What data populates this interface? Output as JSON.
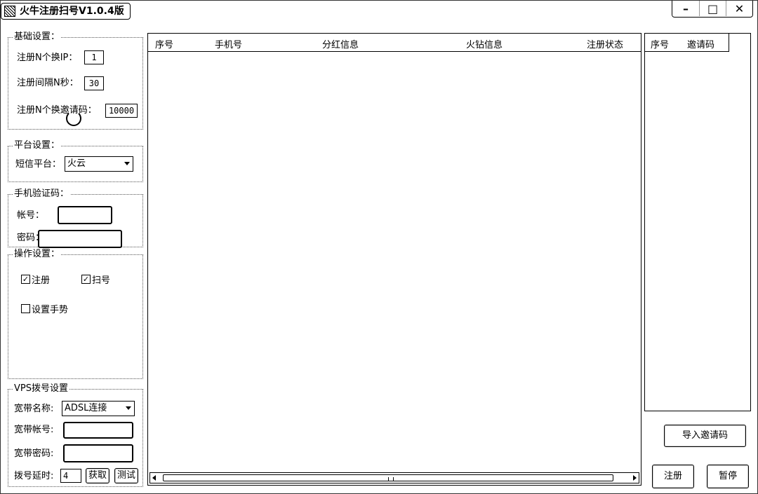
{
  "window": {
    "title": "火牛注册扫号V1.0.4版",
    "minimize_glyph": "–",
    "maximize_glyph": "□",
    "close_glyph": "✕"
  },
  "basic_settings": {
    "title": "基础设置：",
    "switch_ip_label": "注册N个换IP：",
    "switch_ip_value": "1",
    "interval_label": "注册间隔N秒：",
    "interval_value": "30",
    "switch_invite_label": "注册N个换邀请码：",
    "switch_invite_value": "10000"
  },
  "platform_settings": {
    "title": "平台设置：",
    "sms_label": "短信平台：",
    "sms_value": "火云"
  },
  "phone_verify": {
    "title": "手机验证码：",
    "account_label": "帐号：",
    "password_label": "密码："
  },
  "operation_settings": {
    "title": "操作设置：",
    "register_label": "注册",
    "register_checked": true,
    "scan_label": "扫号",
    "scan_checked": true,
    "gesture_label": "设置手势",
    "gesture_checked": false
  },
  "vps_settings": {
    "title": "VPS拨号设置",
    "broadband_name_label": "宽带名称:",
    "broadband_name_value": "ADSL连接",
    "broadband_account_label": "宽带帐号:",
    "broadband_password_label": "宽带密码:",
    "dial_delay_label": "拨号延时:",
    "dial_delay_value": "4",
    "fetch_button": "获取",
    "test_button": "测试"
  },
  "main_list": {
    "columns": [
      "序号",
      "手机号",
      "分红信息",
      "火钻信息",
      "注册状态"
    ]
  },
  "invite_list": {
    "columns": [
      "序号",
      "邀请码"
    ]
  },
  "actions": {
    "import_invite": "导入邀请码",
    "register": "注册",
    "pause": "暂停"
  }
}
